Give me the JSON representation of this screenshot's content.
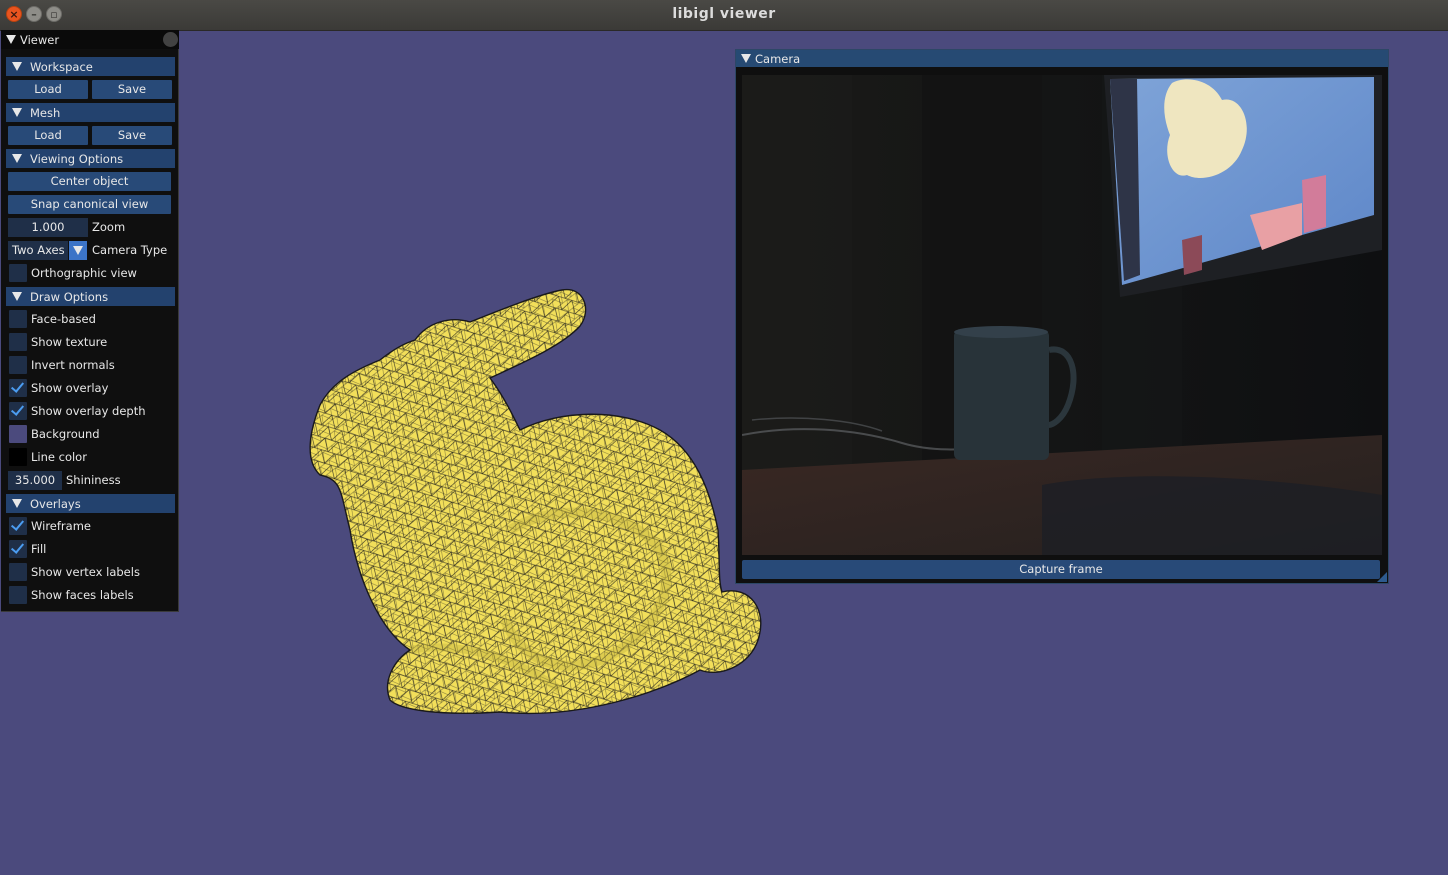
{
  "window": {
    "title": "libigl viewer",
    "close_glyph": "×",
    "min_glyph": "–",
    "max_glyph": "▫"
  },
  "viewer": {
    "title": "Viewer",
    "workspace": {
      "title": "Workspace",
      "load": "Load",
      "save": "Save"
    },
    "mesh": {
      "title": "Mesh",
      "load": "Load",
      "save": "Save"
    },
    "viewing_options": {
      "title": "Viewing Options",
      "center_object": "Center object",
      "snap_canonical_view": "Snap canonical view",
      "zoom_value": "1.000",
      "zoom_label": "Zoom",
      "camera_type_value": "Two Axes",
      "camera_type_label": "Camera Type",
      "orthographic_view": "Orthographic view",
      "orthographic_checked": false
    },
    "draw_options": {
      "title": "Draw Options",
      "face_based": "Face-based",
      "show_texture": "Show texture",
      "invert_normals": "Invert normals",
      "show_overlay": "Show overlay",
      "show_overlay_depth": "Show overlay depth",
      "background": "Background",
      "background_color": "#4b4a7d",
      "line_color": "Line color",
      "line_color_value": "#000000",
      "shininess_value": "35.000",
      "shininess_label": "Shininess",
      "checked": {
        "face_based": false,
        "show_texture": false,
        "invert_normals": false,
        "show_overlay": true,
        "show_overlay_depth": true
      }
    },
    "overlays": {
      "title": "Overlays",
      "wireframe": "Wireframe",
      "fill": "Fill",
      "show_vertex_labels": "Show vertex labels",
      "show_faces_labels": "Show faces labels",
      "checked": {
        "wireframe": true,
        "fill": true,
        "show_vertex_labels": false,
        "show_faces_labels": false
      }
    }
  },
  "camera": {
    "title": "Camera",
    "capture_frame": "Capture frame"
  },
  "colors": {
    "viewport_bg": "#4b4a7d",
    "mesh_fill": "#f2df5a",
    "header_blue": "#23426e",
    "button_blue": "#284a78",
    "check_blue": "#4b9cf0"
  }
}
